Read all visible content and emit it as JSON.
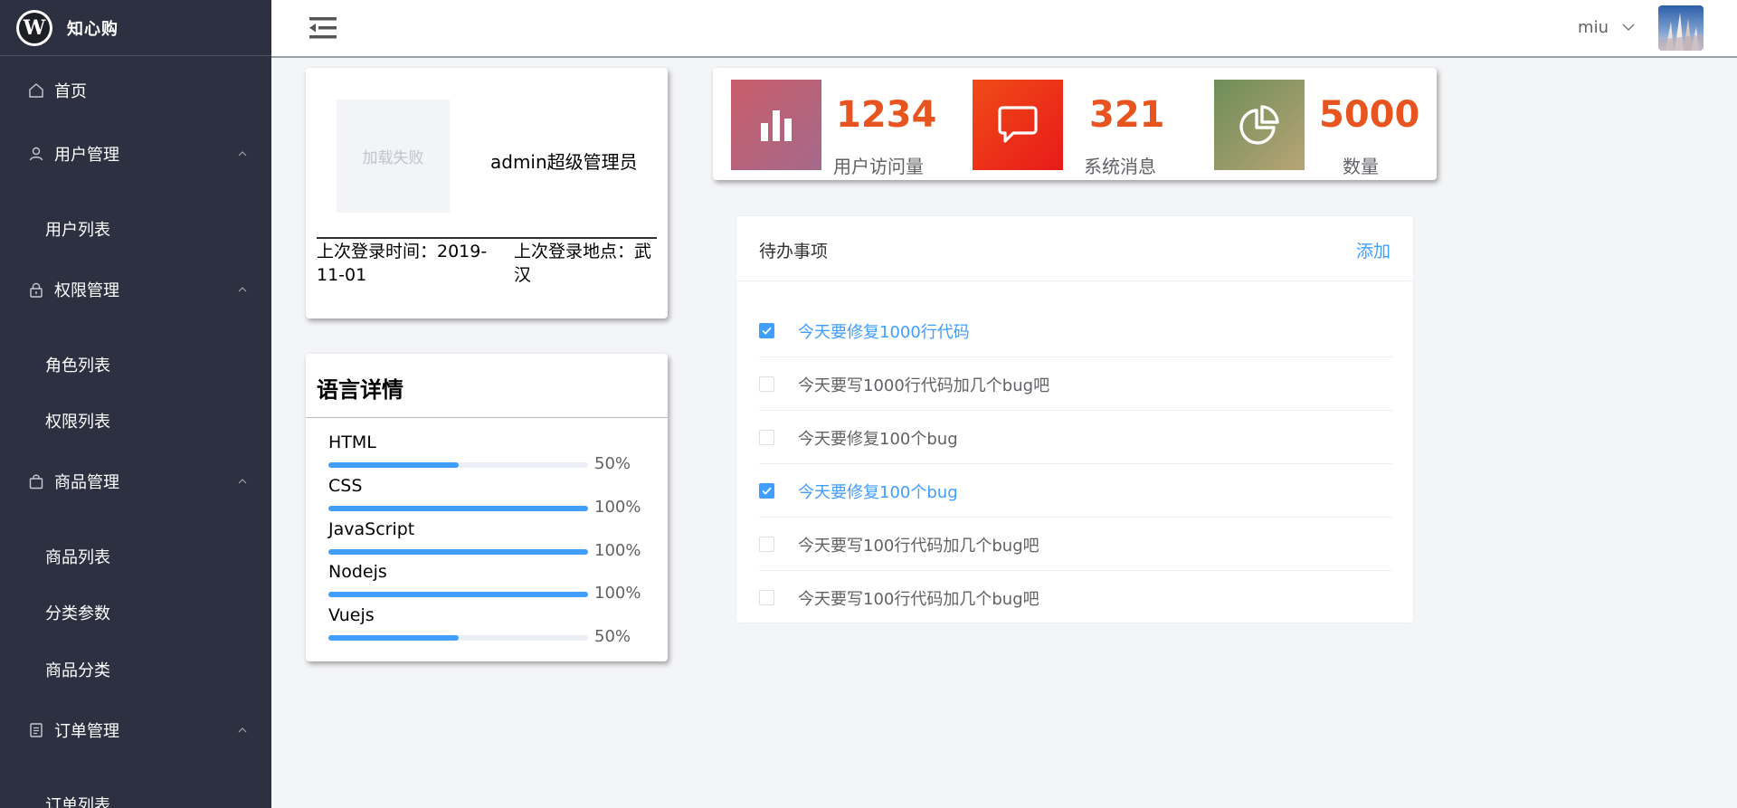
{
  "brand": {
    "logo_letter": "W",
    "name": "知心购"
  },
  "sidebar": {
    "items": [
      {
        "label": "首页",
        "icon": "home-icon"
      },
      {
        "label": "用户管理",
        "icon": "user-icon",
        "children": [
          "用户列表"
        ]
      },
      {
        "label": "权限管理",
        "icon": "lock-icon",
        "children": [
          "角色列表",
          "权限列表"
        ]
      },
      {
        "label": "商品管理",
        "icon": "shopping-bag-icon",
        "children": [
          "商品列表",
          "分类参数",
          "商品分类"
        ]
      },
      {
        "label": "订单管理",
        "icon": "document-icon",
        "children": [
          "订单列表"
        ]
      }
    ]
  },
  "header": {
    "menu_icon": "menu-fold-icon",
    "user_name": "miu"
  },
  "profile": {
    "image_fallback": "加载失败",
    "role": "admin超级管理员",
    "last_login_time": "上次登录时间：2019-11-01",
    "last_login_place": "上次登录地点：武汉"
  },
  "languages": {
    "title": "语言详情",
    "items": [
      {
        "name": "HTML",
        "percent": 50,
        "percent_label": "50%"
      },
      {
        "name": "CSS",
        "percent": 100,
        "percent_label": "100%"
      },
      {
        "name": "JavaScript",
        "percent": 100,
        "percent_label": "100%"
      },
      {
        "name": "Nodejs",
        "percent": 100,
        "percent_label": "100%"
      },
      {
        "name": "Vuejs",
        "percent": 50,
        "percent_label": "50%"
      }
    ]
  },
  "stats": [
    {
      "value": "1234",
      "label": "用户访问量",
      "icon": "bar-chart-icon",
      "color_from": "#c95d6a",
      "color_to": "#a56a8b"
    },
    {
      "value": "321",
      "label": "系统消息",
      "icon": "message-icon",
      "color_from": "#f04b17",
      "color_to": "#e81a1a"
    },
    {
      "value": "5000",
      "label": "数量",
      "icon": "pie-chart-icon",
      "color_from": "#6d8d58",
      "color_to": "#b8a476"
    }
  ],
  "todo": {
    "title": "待办事项",
    "add_label": "添加",
    "items": [
      {
        "text": "今天要修复1000行代码",
        "done": true
      },
      {
        "text": "今天要写1000行代码加几个bug吧",
        "done": false
      },
      {
        "text": "今天要修复100个bug",
        "done": false
      },
      {
        "text": "今天要修复100个bug",
        "done": true
      },
      {
        "text": "今天要写100行代码加几个bug吧",
        "done": false
      },
      {
        "text": "今天要写100行代码加几个bug吧",
        "done": false
      }
    ]
  },
  "colors": {
    "sidebar_bg": "#2d3040",
    "accent": "#409eff",
    "stat_value": "#e8541f"
  }
}
